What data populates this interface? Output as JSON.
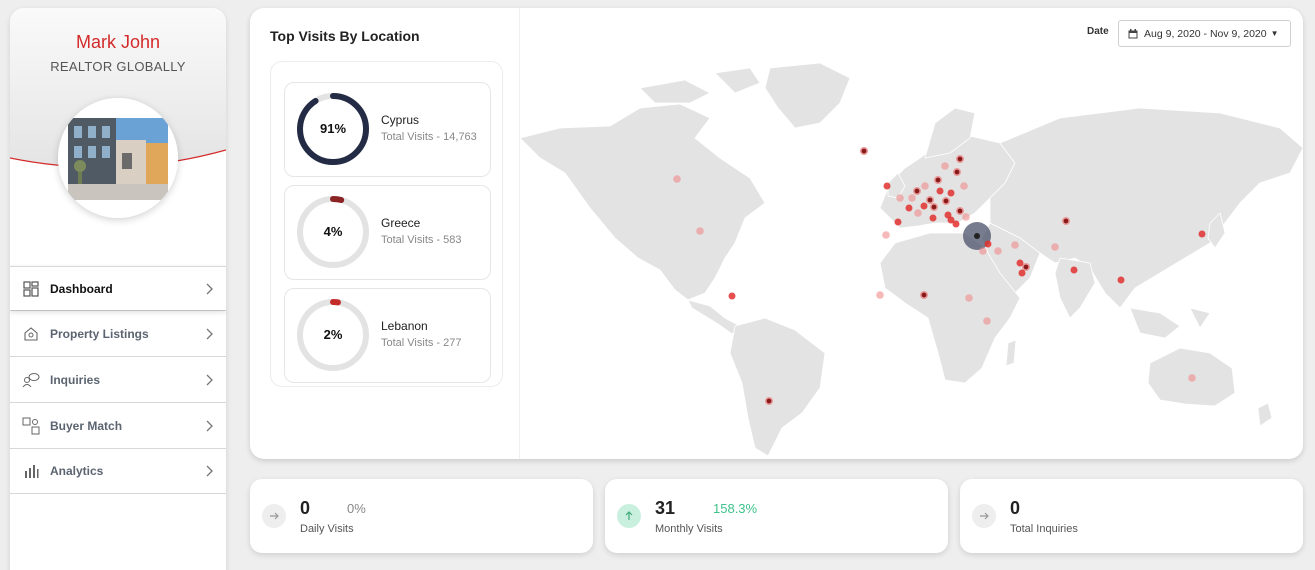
{
  "profile": {
    "name": "Mark John",
    "subtitle": "REALTOR GLOBALLY"
  },
  "nav": {
    "items": [
      {
        "label": "Dashboard",
        "icon": "grid-icon"
      },
      {
        "label": "Property Listings",
        "icon": "house-icon"
      },
      {
        "label": "Inquiries",
        "icon": "people-chat-icon"
      },
      {
        "label": "Buyer Match",
        "icon": "match-icon"
      },
      {
        "label": "Analytics",
        "icon": "bar-chart-icon"
      }
    ]
  },
  "locations": {
    "title": "Top Visits By Location",
    "items": [
      {
        "percent": "91%",
        "country": "Cyprus",
        "visits": "Total Visits - 14,763",
        "fraction": 0.91,
        "color": "#232b45"
      },
      {
        "percent": "4%",
        "country": "Greece",
        "visits": "Total Visits - 583",
        "fraction": 0.04,
        "color": "#8b2324"
      },
      {
        "percent": "2%",
        "country": "Lebanon",
        "visits": "Total Visits - 277",
        "fraction": 0.02,
        "color": "#c42c2c"
      }
    ]
  },
  "date_filter": {
    "label": "Date",
    "range": "Aug 9, 2020 - Nov 9, 2020"
  },
  "stats": [
    {
      "value": "0",
      "change": "0%",
      "label": "Daily Visits",
      "icon": "arrow-right-icon",
      "change_color": "#888888"
    },
    {
      "value": "31",
      "change": "158.3%",
      "label": "Monthly Visits",
      "icon": "arrow-up-icon",
      "change_color": "#3fc38a"
    },
    {
      "value": "0",
      "change": "",
      "label": "Total Inquiries",
      "icon": "arrow-right-icon",
      "change_color": "#888888"
    }
  ],
  "colors": {
    "accent_red": "#d42a2a",
    "navy": "#232b45",
    "positive": "#3fc38a",
    "map_land": "#e3e3e3"
  }
}
